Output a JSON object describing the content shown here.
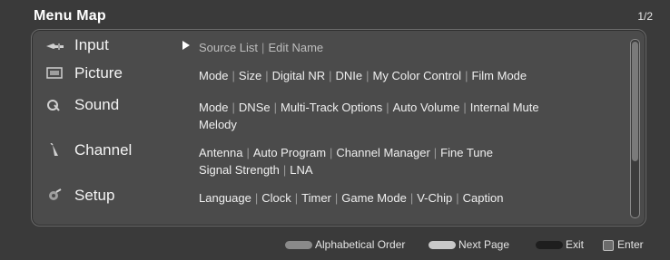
{
  "title": "Menu Map",
  "page_indicator": "1/2",
  "menu": [
    {
      "label": "Input",
      "icon": "input-icon",
      "selected": true,
      "items": [
        "Source List",
        "Edit Name"
      ]
    },
    {
      "label": "Picture",
      "icon": "picture-icon",
      "items": [
        "Mode",
        "Size",
        "Digital NR",
        "DNIe",
        "My Color Control",
        "Film Mode"
      ]
    },
    {
      "label": "Sound",
      "icon": "sound-icon",
      "items": [
        "Mode",
        "DNSe",
        "Multi-Track Options",
        "Auto Volume",
        "Internal Mute",
        "Melody"
      ]
    },
    {
      "label": "Channel",
      "icon": "channel-icon",
      "items": [
        "Antenna",
        "Auto Program",
        "Channel Manager",
        "Fine Tune",
        "Signal Strength",
        "LNA"
      ]
    },
    {
      "label": "Setup",
      "icon": "setup-icon",
      "items": [
        "Language",
        "Clock",
        "Timer",
        "Game Mode",
        "V-Chip",
        "Caption"
      ]
    }
  ],
  "footer": {
    "alphabetical": "Alphabetical Order",
    "next_page": "Next Page",
    "exit": "Exit",
    "enter": "Enter"
  },
  "colors": {
    "background": "#3a3a3a",
    "panel": "#4b4b4b",
    "key_red": "#8a8a8a",
    "key_yellow": "#c9c9c9",
    "key_black": "#1e1e1e"
  }
}
